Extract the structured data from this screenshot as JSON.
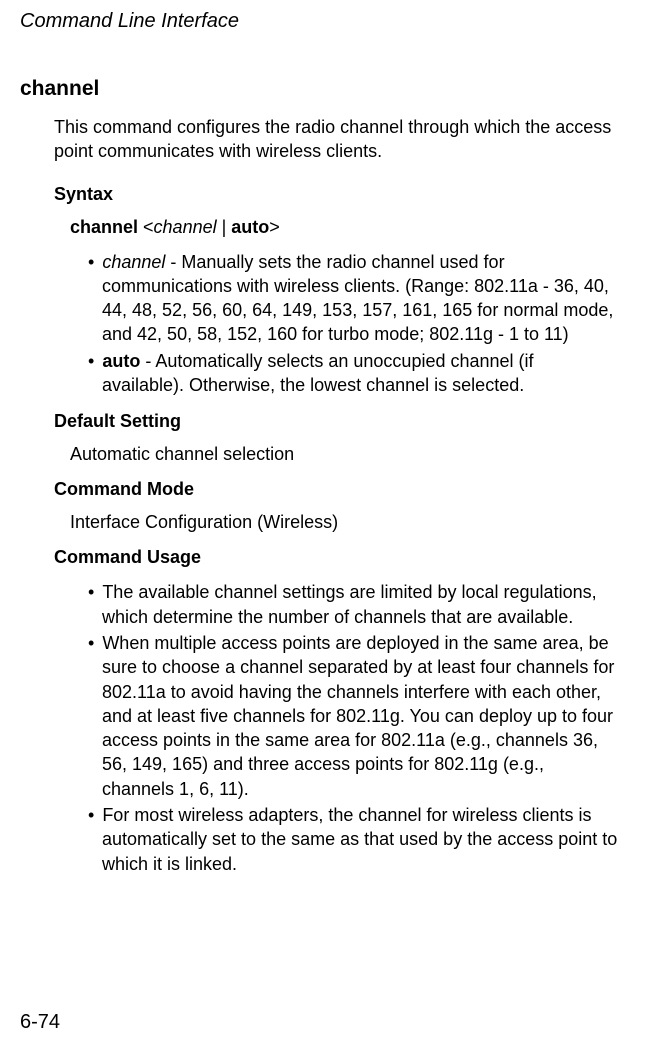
{
  "header": "Command Line Interface",
  "command_title": "channel",
  "intro": "This command configures the radio channel through which the access point communicates with wireless clients.",
  "syntax": {
    "heading": "Syntax",
    "line_prefix_bold": "channel",
    "line_lt": " <",
    "line_param_italic": "channel",
    "line_pipe": " | ",
    "line_auto_bold": "auto",
    "line_gt": ">",
    "options": [
      {
        "term_italic": "channel",
        "desc": " - Manually sets the radio channel used for communications with wireless clients. (Range: 802.11a -  36, 40, 44, 48, 52, 56, 60, 64, 149, 153, 157, 161, 165 for normal mode, and 42, 50, 58, 152, 160 for turbo mode; 802.11g - 1 to 11)"
      },
      {
        "term_bold": "auto",
        "desc": " - Automatically selects an unoccupied channel (if available). Otherwise, the lowest channel is selected."
      }
    ]
  },
  "default_setting": {
    "heading": "Default Setting",
    "value": "Automatic channel selection"
  },
  "command_mode": {
    "heading": "Command Mode",
    "value": "Interface Configuration (Wireless)"
  },
  "command_usage": {
    "heading": "Command Usage",
    "items": [
      "The available channel settings are limited by local regulations, which determine the number of channels that are available.",
      "When multiple access points are deployed in the same area, be sure to choose a channel separated by at least four channels for 802.11a to avoid having the channels interfere with each other, and at least five channels for 802.11g. You can deploy up to four access points in the same area for 802.11a (e.g., channels 36, 56, 149, 165) and three access points for 802.11g (e.g., channels 1, 6, 11).",
      "For most wireless adapters, the channel for wireless clients is automatically set to the same as that used by the access point to which it is linked."
    ]
  },
  "page_number": "6-74"
}
